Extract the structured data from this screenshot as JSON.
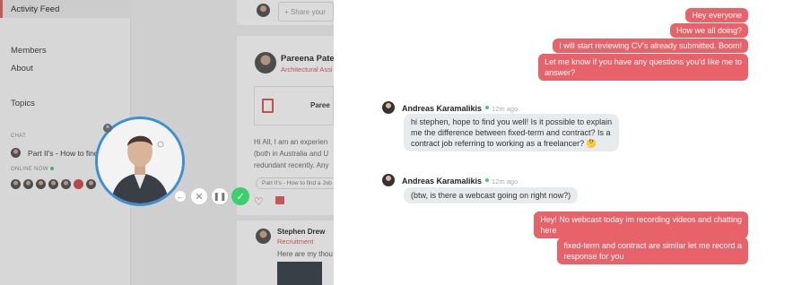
{
  "sidebar": {
    "active_item": "Activity Feed",
    "members": "Members",
    "about": "About",
    "topics": "Topics",
    "chat_label": "CHAT",
    "chat_item": "Part II's - How to find",
    "online_label": "ONLINE NOW"
  },
  "feed": {
    "share_placeholder": "Share your",
    "post": {
      "author": "Pareena Patel",
      "role": "Architectural Assi",
      "attachment": "Paree",
      "lines": [
        "Hi All, I am an experien",
        "(both in Australia and U",
        "redundant recently. Any"
      ],
      "tag": "Part II's - How to find a Job"
    },
    "comment": {
      "author": "Stephen Drew",
      "role": "Recruitment",
      "text": "Here are my thou"
    }
  },
  "video": {
    "close": "×",
    "controls": {
      "back": "←",
      "cancel": "✕",
      "pause": "❚❚",
      "done": "✓"
    }
  },
  "chat": {
    "outgoing_top": [
      "Hey everyone",
      "How we all doing?",
      "I will start reviewing CV's already submitted. Boom!",
      [
        "Let me know if you have any questions you'd like me to",
        "answer?"
      ]
    ],
    "messages": [
      {
        "author": "Andreas Karamalikis",
        "time": "12m ago",
        "lines": [
          "hi stephen, hope to find you well! Is it possible to explain",
          "me the difference between fixed-term and contract? Is a",
          "contract job referring to working as a freelancer? 🤔"
        ]
      },
      {
        "author": "Andreas Karamalikis",
        "time": "12m ago",
        "lines": [
          "(btw, is there a webcast going on right now?)"
        ]
      }
    ],
    "outgoing_bottom": [
      [
        "Hey! No webcast today im recording videos and chatting",
        "here"
      ],
      [
        "fixed-term and contract are similar let me record a",
        "response for you"
      ]
    ]
  }
}
